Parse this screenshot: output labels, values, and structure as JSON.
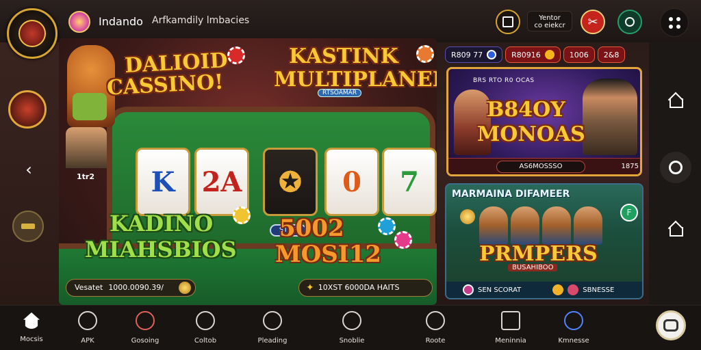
{
  "header": {
    "app_name": "Indando",
    "app_subtitle": "Arfkamdily lmbacies",
    "balance_line1": "Yentor",
    "balance_line2": "co eiekcr"
  },
  "banner": {
    "title_a_line1": "DALIOID",
    "title_a_line2": "CASSINO!",
    "title_b_line1": "KASTINK",
    "title_b_line2": "MULTIPLANER",
    "title_b_tag": "RTSOAMAR",
    "reels": [
      "K",
      "2A",
      "",
      "0",
      "7"
    ],
    "stop_label": "STOP",
    "title_c_line1": "KADINO",
    "title_c_line2": "MIAHSBIOS",
    "title_d_line1": "5002",
    "title_d_line2": "MOSI12",
    "info_bar_left_a": "Vesatet",
    "info_bar_left_b": "1000.0090.39/",
    "info_bar_right": "10XST 6000DA HAITS",
    "rail_tag": "1tr2"
  },
  "promo_top": {
    "pills": [
      "R809 77",
      "R80916",
      "1006",
      "2&8"
    ],
    "title": "BRS RTO R0 OCAS",
    "big_line1": "B84OY",
    "big_line2": "MONOAS",
    "footer_center": "AS6MOSSSO",
    "footer_right": "1875"
  },
  "promo_bottom": {
    "title": "MARMAINA DIFAMEER",
    "big": "PRMPERS",
    "sub": "BUSAHIBOO",
    "footer_a": "SEN SCORAT",
    "footer_b": "SBNESSE",
    "badge": "F"
  },
  "nav": {
    "items": [
      {
        "label": "Mocsis",
        "icon": "home-icon"
      },
      {
        "label": "APK",
        "icon": "globe-icon"
      },
      {
        "label": "Gosoing",
        "icon": "spades-icon"
      },
      {
        "label": "Coltob",
        "icon": "circle-icon"
      },
      {
        "label": "Pleading",
        "icon": "chat-icon"
      },
      {
        "label": "Snoblie",
        "icon": "person-icon"
      },
      {
        "label": "Roote",
        "icon": "ring-icon"
      },
      {
        "label": "Meninnia",
        "icon": "grid-icon"
      },
      {
        "label": "Kmnesse",
        "icon": "search-icon"
      }
    ]
  },
  "colors": {
    "accent_gold": "#d7a531",
    "nav_active": "#4f83ff",
    "felt_green": "#1f6a2c",
    "promo_purple": "#2e1a5a"
  }
}
